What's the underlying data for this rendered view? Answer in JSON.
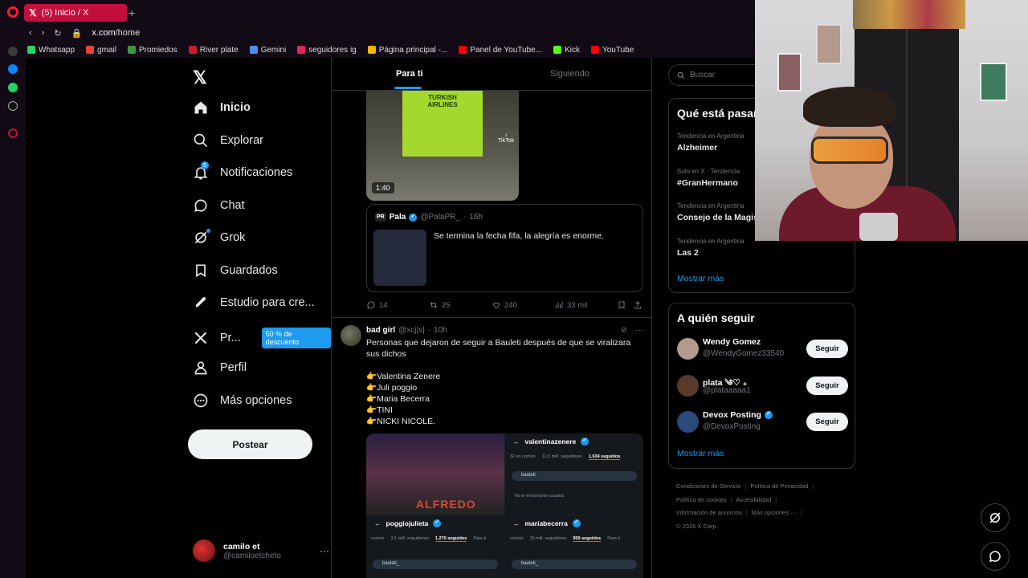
{
  "browser": {
    "tab_title": "(5) Inicio / X",
    "url_host": "x.com",
    "url_path": "/home",
    "bookmarks": [
      {
        "label": "Whatsapp",
        "color": "#25d366"
      },
      {
        "label": "gmail",
        "color": "#ea4335"
      },
      {
        "label": "Promiedos",
        "color": "#3a9a3a"
      },
      {
        "label": "River plate",
        "color": "#d01c2a"
      },
      {
        "label": "Gemini",
        "color": "#4f8cf4"
      },
      {
        "label": "seguidores ig",
        "color": "#e0245e"
      },
      {
        "label": "Página principal -...",
        "color": "#f4b400"
      },
      {
        "label": "Panel de YouTube...",
        "color": "#ff0000"
      },
      {
        "label": "Kick",
        "color": "#53fc18"
      },
      {
        "label": "YouTube",
        "color": "#ff0000"
      }
    ]
  },
  "nav": {
    "items": [
      {
        "label": "Inicio",
        "icon": "home-icon"
      },
      {
        "label": "Explorar",
        "icon": "search-icon"
      },
      {
        "label": "Notificaciones",
        "icon": "bell-icon",
        "badge": "5"
      },
      {
        "label": "Chat",
        "icon": "chat-icon"
      },
      {
        "label": "Grok",
        "icon": "grok-icon"
      },
      {
        "label": "Guardados",
        "icon": "bookmark-icon"
      },
      {
        "label": "Estudio para cre...",
        "icon": "rocket-icon"
      },
      {
        "label": "Pr...",
        "icon": "x-premium-icon",
        "promo": "50 % de descuento"
      },
      {
        "label": "Perfil",
        "icon": "person-icon"
      },
      {
        "label": "Más opciones",
        "icon": "more-circle-icon"
      }
    ],
    "post_button": "Postear",
    "account": {
      "name": "camilo et",
      "handle": "@camiloetcheto"
    }
  },
  "timeline": {
    "tabs": {
      "for_you": "Para ti",
      "following": "Siguiendo"
    },
    "tweet1": {
      "video_duration": "1:40",
      "jersey_text": "TURKISH AIRLINES",
      "tiktok_label": "TikTok",
      "quote": {
        "name": "Pala",
        "handle": "@PalaPR_",
        "time": "16h",
        "badge": "PR",
        "text": "Se termina la fecha fifa, la alegría es enorme."
      },
      "stats": {
        "replies": "14",
        "reposts": "25",
        "likes": "240",
        "views": "33 mil"
      }
    },
    "tweet2": {
      "name": "bad girl",
      "handle": "@xcj|s|",
      "time": "10h",
      "lines": [
        "Personas que dejaron de seguir a Bauleti después de que se viralizara sus dichos",
        "",
        "👉Valentina Zenere",
        "👉Juli poggio",
        "👉Maria Becerra",
        "👉TINI",
        "👉NICKI NICOLE."
      ],
      "media": {
        "alfredo": "ALFREDO",
        "panel2": {
          "user": "valentinazenere",
          "stats": [
            "32 en común",
            "11,5 mill. seguidores",
            "1.634 seguidos"
          ],
          "search": "bauleti",
          "empty": "No se encontraron usuarios."
        },
        "panel3": {
          "user": "poggiojulieta",
          "stats": [
            "común",
            "3,1 mill. seguidores",
            "1.270 seguidos",
            "Para ti"
          ],
          "search": "bauleti_"
        },
        "panel4": {
          "user": "mariabecerra",
          "stats": [
            "común",
            "15 mill. seguidores",
            "959 seguidos",
            "Para ti"
          ],
          "search": "bauleti_"
        }
      }
    }
  },
  "right": {
    "search_placeholder": "Buscar",
    "trends_title": "Qué está pasan",
    "trends": [
      {
        "context": "Tendencia en Argentina",
        "name": "Alzheimer"
      },
      {
        "context": "Solo en X · Tendencia",
        "name": "#GranHermano"
      },
      {
        "context": "Tendencia en Argentina",
        "name": "Consejo de la Magist"
      },
      {
        "context": "Tendencia en Argentina",
        "name": "Las 2"
      }
    ],
    "trends_more": "Mostrar más",
    "follow_title": "A quién seguir",
    "suggestions": [
      {
        "name": "Wendy Gomez",
        "handle": "@WendyGomez33540",
        "verified": false,
        "button": "Seguir",
        "color": "#b49a8c"
      },
      {
        "name": "plata ༄♡ ₊",
        "handle": "@plataaaaa1",
        "verified": false,
        "button": "Seguir",
        "color": "#5a3a2a"
      },
      {
        "name": "Devox Posting",
        "handle": "@DevoxPosting",
        "verified": true,
        "button": "Seguir",
        "color": "#2a4a7a"
      }
    ],
    "follow_more": "Mostrar más",
    "footer": {
      "row1": [
        "Condiciones de Servicio",
        "Política de Privacidad"
      ],
      "row2": [
        "Política de cookies",
        "Accesibilidad"
      ],
      "row3": [
        "Información de anuncios",
        "Más opciones ···"
      ],
      "copyright": "© 2026 X Corp."
    }
  }
}
